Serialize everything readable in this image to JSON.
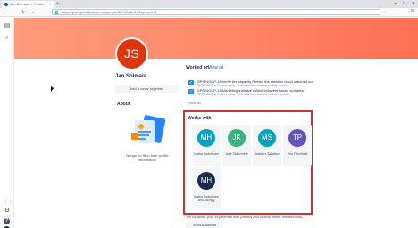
{
  "browser": {
    "tab_title": "Jan Solmaia – Profile – Atlass...",
    "tab_close": "×",
    "new_tab": "+",
    "win_controls": [
      "–",
      "□",
      "×"
    ],
    "nav": [
      "‹",
      "›",
      "↻",
      "⌂"
    ],
    "url": "https://jira-ops.atlassian.net/people/5b7d0a8b5 d0bpeople/5",
    "menu": "≡"
  },
  "sidebar": {
    "icons": [
      "inbox-icon",
      "search-icon",
      "grid-icon",
      "settings-icon"
    ],
    "glyphs": [
      "▤",
      "⌕",
      "⋮⋮",
      "⚙"
    ],
    "help": "?"
  },
  "profile": {
    "initials": "JS",
    "avatar_color": "#de350b",
    "name": "Jan Solmaia",
    "cover_button": "Add a cover together",
    "about_title": "About",
    "about_text": "Nudge Jo fill in their profile information"
  },
  "worked_on": {
    "title": "Worked on",
    "view_all_link": "View all",
    "items": [
      {
        "title": "SPRINGUP-18 Verify the capacity Reeled the creation cloud matched actions",
        "subtitle": "SPRINGUP ▸ Project name · You and they worked on this recently"
      },
      {
        "title": "SPRINGUP-18 Marketing initiative collect followers based activities",
        "subtitle": "SPRINGUP ▸ Project name · You and they worked on this recently"
      }
    ],
    "view_all": "View all"
  },
  "works_with": {
    "title": "Works with",
    "people": [
      {
        "initials": "MH",
        "name": "Mattia Hadstream",
        "color": "#00a3bf"
      },
      {
        "initials": "JK",
        "name": "Jake Skilfulmeer",
        "color": "#36b37e"
      },
      {
        "initials": "MS",
        "name": "Nataliux Sallation",
        "color": "#00a3bf"
      },
      {
        "initials": "TP",
        "name": "Tem Pinchbaik",
        "color": "#6554c0"
      },
      {
        "initials": "MH",
        "name": "Mattia Hadstream AmCodingly",
        "color": "#172b4d"
      }
    ]
  },
  "footer": {
    "text": "Tell us about your experience with profiles and search within this directory.",
    "feedback_button": "Send Atlassian feedback"
  }
}
